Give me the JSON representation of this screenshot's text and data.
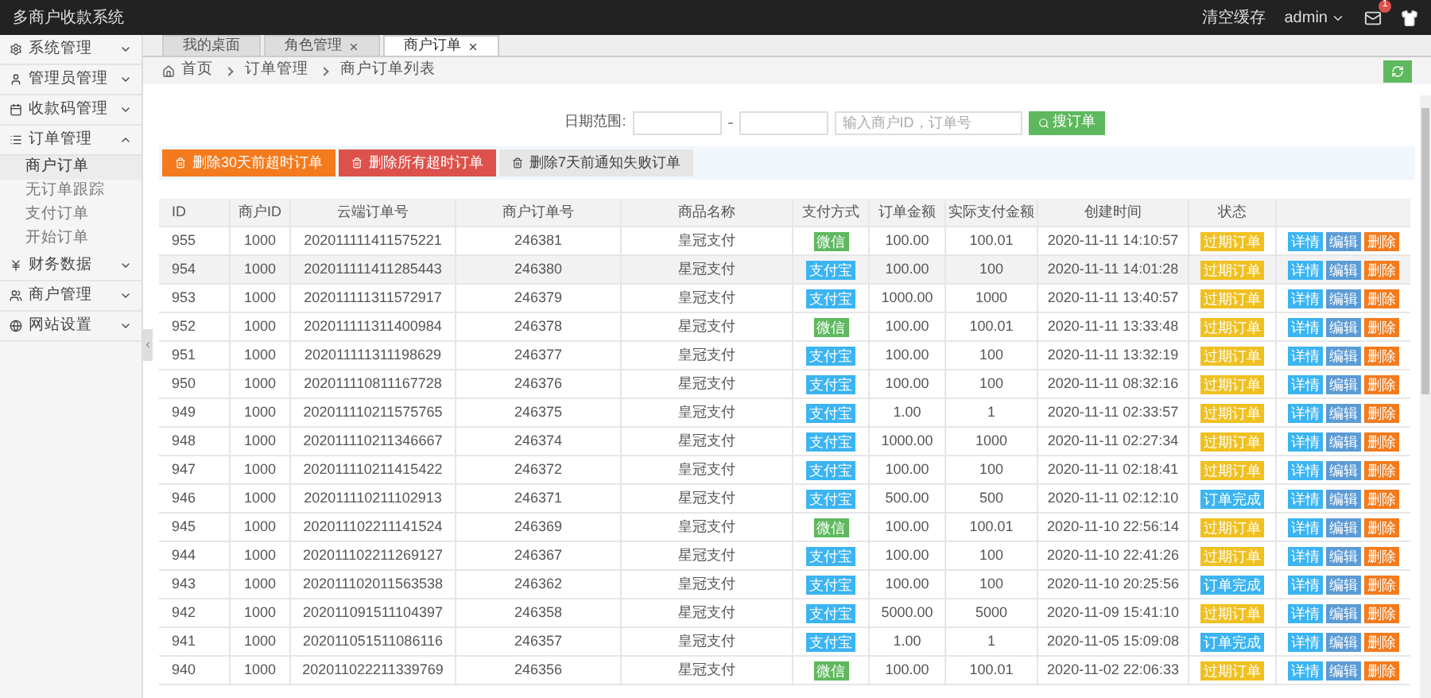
{
  "app": {
    "title": "多商户收款系统"
  },
  "header": {
    "clear_cache": "清空缓存",
    "user": "admin",
    "mail_badge": "1"
  },
  "sidebar": {
    "items": [
      {
        "label": "系统管理",
        "expanded": false
      },
      {
        "label": "管理员管理",
        "expanded": false
      },
      {
        "label": "收款码管理",
        "expanded": false
      },
      {
        "label": "订单管理",
        "expanded": true,
        "children": [
          {
            "label": "商户订单",
            "selected": true
          },
          {
            "label": "无订单跟踪",
            "selected": false
          },
          {
            "label": "支付订单",
            "selected": false
          },
          {
            "label": "开始订单",
            "selected": false
          }
        ]
      },
      {
        "label": "财务数据",
        "expanded": false
      },
      {
        "label": "商户管理",
        "expanded": false
      },
      {
        "label": "网站设置",
        "expanded": false
      }
    ]
  },
  "tabs": [
    {
      "label": "我的桌面",
      "selected": false,
      "closable": false
    },
    {
      "label": "角色管理",
      "selected": false,
      "closable": true
    },
    {
      "label": "商户订单",
      "selected": true,
      "closable": true
    }
  ],
  "breadcrumb": [
    "首页",
    "订单管理",
    "商户订单列表"
  ],
  "filter": {
    "date_label": "日期范围:",
    "search_placeholder": "输入商户ID，订单号",
    "search_button": "搜订单"
  },
  "actions": [
    {
      "label": "删除30天前超时订单",
      "kind": "orange"
    },
    {
      "label": "删除所有超时订单",
      "kind": "red"
    },
    {
      "label": "删除7天前通知失败订单",
      "kind": "plain"
    }
  ],
  "table": {
    "columns": [
      "ID",
      "商户ID",
      "云端订单号",
      "商户订单号",
      "商品名称",
      "支付方式",
      "订单金额",
      "实际支付金额",
      "创建时间",
      "状态"
    ],
    "rows": [
      {
        "cells": [
          "955",
          "1000",
          "202011111411575221",
          "246381",
          "皇冠支付"
        ],
        "pay": {
          "label": "微信",
          "kind": "wechat"
        },
        "cells2": [
          "100.00",
          "100.01",
          "2020-11-11 14:10:57"
        ],
        "status": {
          "label": "过期订单",
          "kind": "expired"
        },
        "buttons": [
          {
            "label": "详情",
            "kind": "detail"
          },
          {
            "label": "编辑",
            "kind": "edit"
          },
          {
            "label": "删除",
            "kind": "delete"
          }
        ]
      },
      {
        "cells": [
          "954",
          "1000",
          "202011111411285443",
          "246380",
          "星冠支付"
        ],
        "pay": {
          "label": "支付宝",
          "kind": "alipay"
        },
        "cells2": [
          "100.00",
          "100",
          "2020-11-11 14:01:28"
        ],
        "status": {
          "label": "过期订单",
          "kind": "expired"
        },
        "buttons": [
          {
            "label": "详情",
            "kind": "detail"
          },
          {
            "label": "编辑",
            "kind": "edit"
          },
          {
            "label": "删除",
            "kind": "delete"
          }
        ]
      },
      {
        "cells": [
          "953",
          "1000",
          "202011111311572917",
          "246379",
          "皇冠支付"
        ],
        "pay": {
          "label": "支付宝",
          "kind": "alipay"
        },
        "cells2": [
          "1000.00",
          "1000",
          "2020-11-11 13:40:57"
        ],
        "status": {
          "label": "过期订单",
          "kind": "expired"
        },
        "buttons": [
          {
            "label": "详情",
            "kind": "detail"
          },
          {
            "label": "编辑",
            "kind": "edit"
          },
          {
            "label": "删除",
            "kind": "delete"
          }
        ]
      },
      {
        "cells": [
          "952",
          "1000",
          "202011111311400984",
          "246378",
          "星冠支付"
        ],
        "pay": {
          "label": "微信",
          "kind": "wechat"
        },
        "cells2": [
          "100.00",
          "100.01",
          "2020-11-11 13:33:48"
        ],
        "status": {
          "label": "过期订单",
          "kind": "expired"
        },
        "buttons": [
          {
            "label": "详情",
            "kind": "detail"
          },
          {
            "label": "编辑",
            "kind": "edit"
          },
          {
            "label": "删除",
            "kind": "delete"
          }
        ]
      },
      {
        "cells": [
          "951",
          "1000",
          "202011111311198629",
          "246377",
          "皇冠支付"
        ],
        "pay": {
          "label": "支付宝",
          "kind": "alipay"
        },
        "cells2": [
          "100.00",
          "100",
          "2020-11-11 13:32:19"
        ],
        "status": {
          "label": "过期订单",
          "kind": "expired"
        },
        "buttons": [
          {
            "label": "详情",
            "kind": "detail"
          },
          {
            "label": "编辑",
            "kind": "edit"
          },
          {
            "label": "删除",
            "kind": "delete"
          }
        ]
      },
      {
        "cells": [
          "950",
          "1000",
          "202011110811167728",
          "246376",
          "星冠支付"
        ],
        "pay": {
          "label": "支付宝",
          "kind": "alipay"
        },
        "cells2": [
          "100.00",
          "100",
          "2020-11-11 08:32:16"
        ],
        "status": {
          "label": "过期订单",
          "kind": "expired"
        },
        "buttons": [
          {
            "label": "详情",
            "kind": "detail"
          },
          {
            "label": "编辑",
            "kind": "edit"
          },
          {
            "label": "删除",
            "kind": "delete"
          }
        ]
      },
      {
        "cells": [
          "949",
          "1000",
          "202011110211575765",
          "246375",
          "皇冠支付"
        ],
        "pay": {
          "label": "支付宝",
          "kind": "alipay"
        },
        "cells2": [
          "1.00",
          "1",
          "2020-11-11 02:33:57"
        ],
        "status": {
          "label": "过期订单",
          "kind": "expired"
        },
        "buttons": [
          {
            "label": "详情",
            "kind": "detail"
          },
          {
            "label": "编辑",
            "kind": "edit"
          },
          {
            "label": "删除",
            "kind": "delete"
          }
        ]
      },
      {
        "cells": [
          "948",
          "1000",
          "202011110211346667",
          "246374",
          "星冠支付"
        ],
        "pay": {
          "label": "支付宝",
          "kind": "alipay"
        },
        "cells2": [
          "1000.00",
          "1000",
          "2020-11-11 02:27:34"
        ],
        "status": {
          "label": "过期订单",
          "kind": "expired"
        },
        "buttons": [
          {
            "label": "详情",
            "kind": "detail"
          },
          {
            "label": "编辑",
            "kind": "edit"
          },
          {
            "label": "删除",
            "kind": "delete"
          }
        ]
      },
      {
        "cells": [
          "947",
          "1000",
          "202011110211415422",
          "246372",
          "皇冠支付"
        ],
        "pay": {
          "label": "支付宝",
          "kind": "alipay"
        },
        "cells2": [
          "100.00",
          "100",
          "2020-11-11 02:18:41"
        ],
        "status": {
          "label": "过期订单",
          "kind": "expired"
        },
        "buttons": [
          {
            "label": "详情",
            "kind": "detail"
          },
          {
            "label": "编辑",
            "kind": "edit"
          },
          {
            "label": "删除",
            "kind": "delete"
          }
        ]
      },
      {
        "cells": [
          "946",
          "1000",
          "202011110211102913",
          "246371",
          "星冠支付"
        ],
        "pay": {
          "label": "支付宝",
          "kind": "alipay"
        },
        "cells2": [
          "500.00",
          "500",
          "2020-11-11 02:12:10"
        ],
        "status": {
          "label": "订单完成",
          "kind": "done"
        },
        "buttons": [
          {
            "label": "详情",
            "kind": "detail"
          },
          {
            "label": "编辑",
            "kind": "edit"
          },
          {
            "label": "删除",
            "kind": "delete"
          }
        ]
      },
      {
        "cells": [
          "945",
          "1000",
          "202011102211141524",
          "246369",
          "皇冠支付"
        ],
        "pay": {
          "label": "微信",
          "kind": "wechat"
        },
        "cells2": [
          "100.00",
          "100.01",
          "2020-11-10 22:56:14"
        ],
        "status": {
          "label": "过期订单",
          "kind": "expired"
        },
        "buttons": [
          {
            "label": "详情",
            "kind": "detail"
          },
          {
            "label": "编辑",
            "kind": "edit"
          },
          {
            "label": "删除",
            "kind": "delete"
          }
        ]
      },
      {
        "cells": [
          "944",
          "1000",
          "202011102211269127",
          "246367",
          "星冠支付"
        ],
        "pay": {
          "label": "支付宝",
          "kind": "alipay"
        },
        "cells2": [
          "100.00",
          "100",
          "2020-11-10 22:41:26"
        ],
        "status": {
          "label": "过期订单",
          "kind": "expired"
        },
        "buttons": [
          {
            "label": "详情",
            "kind": "detail"
          },
          {
            "label": "编辑",
            "kind": "edit"
          },
          {
            "label": "删除",
            "kind": "delete"
          }
        ]
      },
      {
        "cells": [
          "943",
          "1000",
          "202011102011563538",
          "246362",
          "皇冠支付"
        ],
        "pay": {
          "label": "支付宝",
          "kind": "alipay"
        },
        "cells2": [
          "100.00",
          "100",
          "2020-11-10 20:25:56"
        ],
        "status": {
          "label": "订单完成",
          "kind": "done"
        },
        "buttons": [
          {
            "label": "详情",
            "kind": "detail"
          },
          {
            "label": "编辑",
            "kind": "edit"
          },
          {
            "label": "删除",
            "kind": "delete"
          }
        ]
      },
      {
        "cells": [
          "942",
          "1000",
          "202011091511104397",
          "246358",
          "星冠支付"
        ],
        "pay": {
          "label": "支付宝",
          "kind": "alipay"
        },
        "cells2": [
          "5000.00",
          "5000",
          "2020-11-09 15:41:10"
        ],
        "status": {
          "label": "过期订单",
          "kind": "expired"
        },
        "buttons": [
          {
            "label": "详情",
            "kind": "detail"
          },
          {
            "label": "编辑",
            "kind": "edit"
          },
          {
            "label": "删除",
            "kind": "delete"
          }
        ]
      },
      {
        "cells": [
          "941",
          "1000",
          "202011051511086116",
          "246357",
          "皇冠支付"
        ],
        "pay": {
          "label": "支付宝",
          "kind": "alipay"
        },
        "cells2": [
          "1.00",
          "1",
          "2020-11-05 15:09:08"
        ],
        "status": {
          "label": "订单完成",
          "kind": "done"
        },
        "buttons": [
          {
            "label": "详情",
            "kind": "detail"
          },
          {
            "label": "编辑",
            "kind": "edit"
          },
          {
            "label": "删除",
            "kind": "delete"
          }
        ]
      },
      {
        "cells": [
          "940",
          "1000",
          "202011022211339769",
          "246356",
          "星冠支付"
        ],
        "pay": {
          "label": "微信",
          "kind": "wechat"
        },
        "cells2": [
          "100.00",
          "100.01",
          "2020-11-02 22:06:33"
        ],
        "status": {
          "label": "过期订单",
          "kind": "expired"
        },
        "buttons": [
          {
            "label": "详情",
            "kind": "detail"
          },
          {
            "label": "编辑",
            "kind": "edit"
          },
          {
            "label": "删除",
            "kind": "delete"
          }
        ]
      }
    ]
  }
}
